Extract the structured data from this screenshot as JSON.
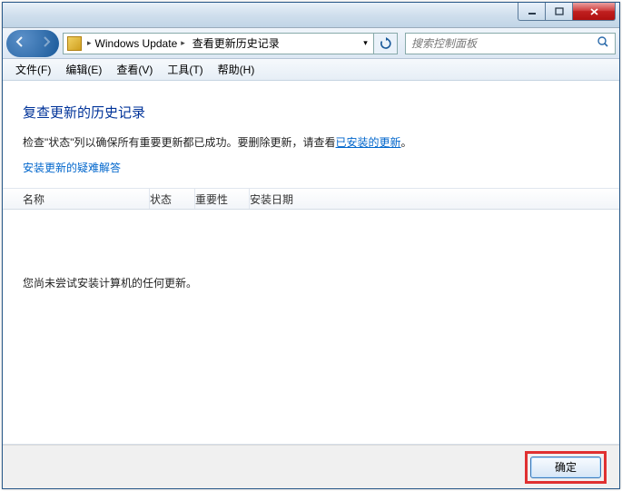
{
  "titlebar": {},
  "nav": {
    "breadcrumb": {
      "seg1": "Windows Update",
      "seg2": "查看更新历史记录"
    },
    "search_placeholder": "搜索控制面板"
  },
  "menu": {
    "file": "文件(F)",
    "edit": "编辑(E)",
    "view": "查看(V)",
    "tools": "工具(T)",
    "help": "帮助(H)"
  },
  "content": {
    "heading": "复查更新的历史记录",
    "desc_prefix": "检查\"状态\"列以确保所有重要更新都已成功。要删除更新，请查看",
    "desc_link": "已安装的更新",
    "desc_suffix": "。",
    "troubleshoot": "安装更新的疑难解答"
  },
  "columns": {
    "name": "名称",
    "status": "状态",
    "importance": "重要性",
    "date": "安装日期"
  },
  "empty": "您尚未尝试安装计算机的任何更新。",
  "footer": {
    "ok": "确定"
  }
}
